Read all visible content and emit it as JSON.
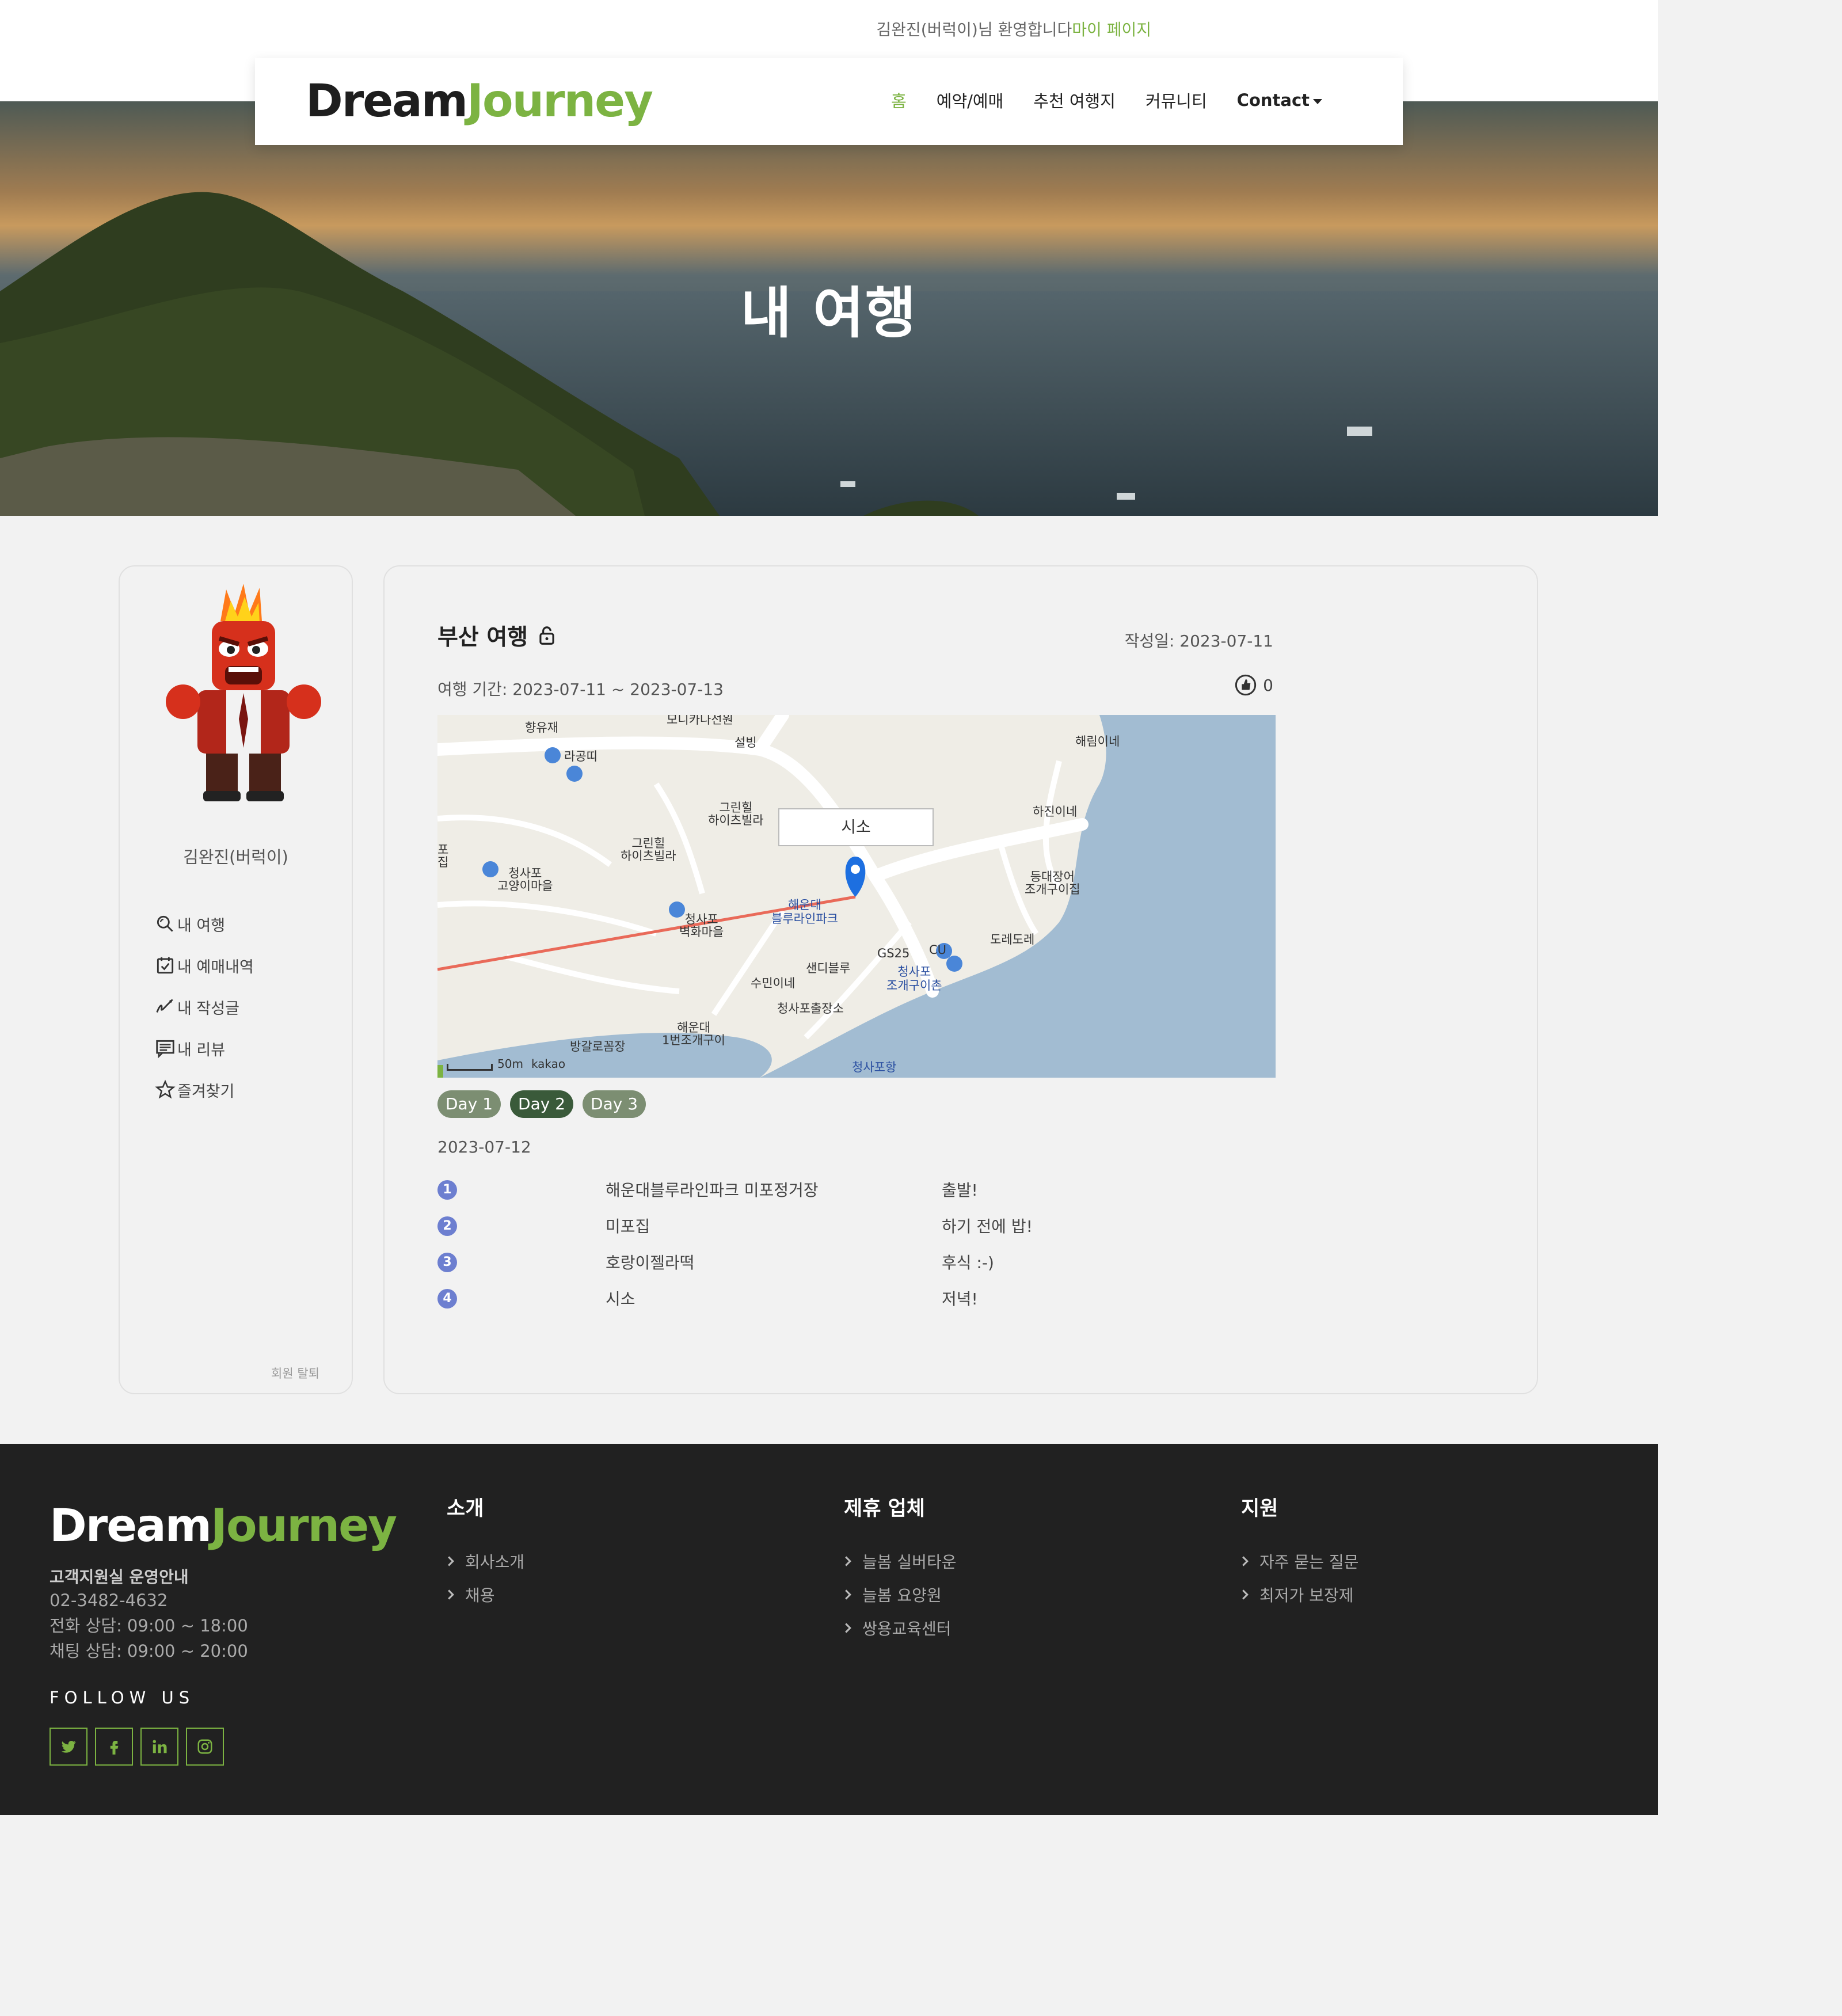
{
  "header": {
    "welcome": "김완진(버럭이)님 환영합니다",
    "mypage": "마이 페이지"
  },
  "brand": {
    "dream": "Dream",
    "journey": "Journey"
  },
  "nav": {
    "items": [
      "홈",
      "예약/예매",
      "추천 여행지",
      "커뮤니티"
    ],
    "contact": "Contact"
  },
  "hero": {
    "title": "내 여행"
  },
  "sidebar": {
    "user_name": "김완진(버럭이)",
    "menu": [
      "내 여행",
      "내 예매내역",
      "내 작성글",
      "내 리뷰",
      "즐겨찾기"
    ],
    "withdraw": "회원 탈퇴"
  },
  "trip": {
    "title": "부산 여행",
    "written": "작성일: 2023-07-11",
    "period": "여행 기간: 2023-07-11 ~ 2023-07-13",
    "likes": "0",
    "days": [
      "Day 1",
      "Day 2",
      "Day 3"
    ],
    "active_day": "Day 2",
    "date": "2023-07-12",
    "schedule": [
      {
        "no": "1",
        "place": "해운대블루라인파크 미포정거장",
        "memo": "출발!"
      },
      {
        "no": "2",
        "place": "미포집",
        "memo": "하기 전에 밥!"
      },
      {
        "no": "3",
        "place": "호랑이젤라떡",
        "memo": "후식 :-)"
      },
      {
        "no": "4",
        "place": "시소",
        "memo": "저녁!"
      }
    ]
  },
  "map": {
    "popup": "시소",
    "scale": "50m",
    "provider": "kakao",
    "labels": {
      "hyangyujae": "향유재",
      "monica": "모니카나선원",
      "seolbing": "설빙",
      "haerim": "해림이네",
      "ragongtti": "라공띠",
      "greenhill1": "그린힐\n하이츠빌라",
      "greenhill2": "그린힐\n하이츠빌라",
      "hajin": "하진이네",
      "cheongsapo_cat": "청사포\n고양이마을",
      "deungdae": "등대장어\n조개구이집",
      "bluelinepark": "해운대\n블루라인파크",
      "mural": "청사포\n벽화마을",
      "doredore": "도레도레",
      "sandyblue": "샌디블루",
      "gs25": "GS25",
      "cu": "CU",
      "sumin": "수민이네",
      "cheongsapo_clam": "청사포\n조개구이촌",
      "cheongsapo_branch": "청사포출장소",
      "banggalo": "방갈로꼼장",
      "clam1": "해운대\n1번조개구이",
      "port": "청사포항",
      "po": "포",
      "jip": "집"
    }
  },
  "footer": {
    "support_title": "고객지원실 운영안내",
    "phone": "02-3482-4632",
    "call_hours": "전화 상담: 09:00 ~ 18:00",
    "chat_hours": "채팅 상담: 09:00 ~ 20:00",
    "follow": "FOLLOW US",
    "socials": [
      "twitter-icon",
      "facebook-icon",
      "linkedin-icon",
      "instagram-icon"
    ],
    "cols": [
      {
        "title": "소개",
        "links": [
          "회사소개",
          "채용"
        ]
      },
      {
        "title": "제휴 업체",
        "links": [
          "늘봄 실버타운",
          "늘봄 요양원",
          "쌍용교육센터"
        ]
      },
      {
        "title": "지원",
        "links": [
          "자주 묻는 질문",
          "최저가 보장제"
        ]
      }
    ]
  },
  "colors": {
    "accent": "#7cb342",
    "footer_bg": "#212121",
    "day_active": "#3a5a3a",
    "marker": "#1d6fe0"
  }
}
